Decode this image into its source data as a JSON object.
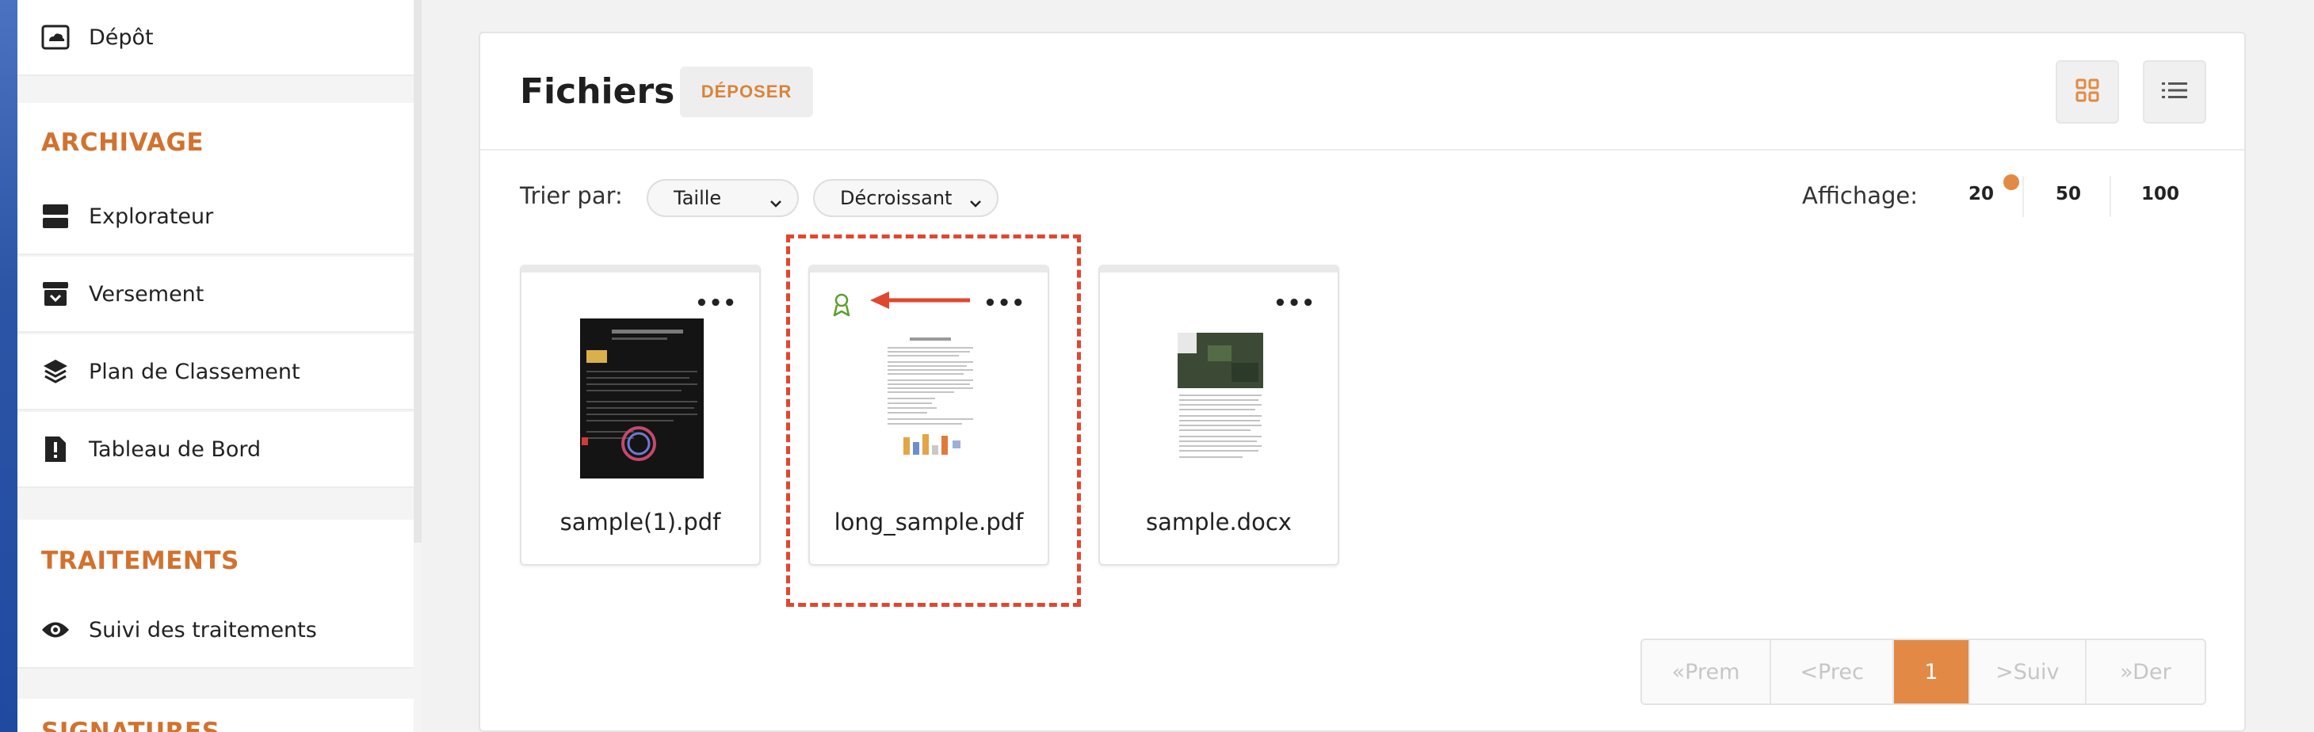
{
  "sidebar": {
    "depot": "Dépôt",
    "sections": [
      {
        "title": "ARCHIVAGE",
        "items": [
          "Explorateur",
          "Versement",
          "Plan de Classement",
          "Tableau de Bord"
        ]
      },
      {
        "title": "TRAITEMENTS",
        "items": [
          "Suivi des traitements"
        ]
      },
      {
        "title": "SIGNATURES",
        "items": []
      }
    ]
  },
  "main": {
    "title": "Fichiers",
    "upload_label": "DÉPOSER",
    "sort_label": "Trier par:",
    "sort_field": "Taille",
    "sort_order": "Décroissant",
    "display_label": "Affichage:",
    "page_sizes": [
      "20",
      "50",
      "100"
    ],
    "selected_page_size": "20",
    "files": [
      {
        "name": "sample(1).pdf",
        "menu": "•••"
      },
      {
        "name": "long_sample.pdf",
        "menu": "•••"
      },
      {
        "name": "sample.docx",
        "menu": "•••"
      }
    ],
    "pagination": [
      "«Prem",
      "<Prec",
      "1",
      ">Suiv",
      "»Der"
    ],
    "current_page": "1"
  },
  "colors": {
    "accent": "#d1722f",
    "active_page": "#e28a45",
    "highlight": "#e0472f",
    "certified_icon": "#5aa02c"
  }
}
